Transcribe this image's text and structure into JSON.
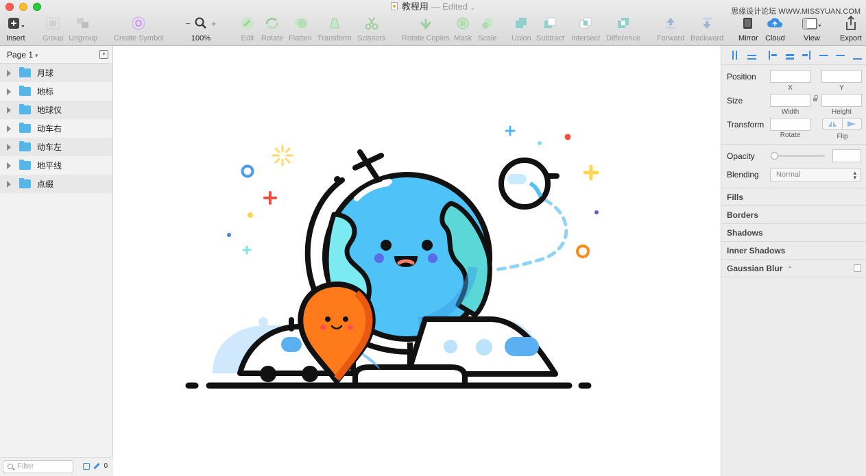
{
  "window": {
    "title": "教程用",
    "edited": "— Edited",
    "watermark": "思缘设计论坛 WWW.MISSYUAN.COM"
  },
  "toolbar": {
    "insert": "Insert",
    "group": "Group",
    "ungroup": "Ungroup",
    "create_symbol": "Create Symbol",
    "zoom_value": "100%",
    "zoom_minus": "−",
    "zoom_plus": "+",
    "edit": "Edit",
    "rotate": "Rotate",
    "flatten": "Flatten",
    "transform": "Transform",
    "scissors": "Scissors",
    "rotate_copies": "Rotate Copies",
    "mask": "Mask",
    "scale": "Scale",
    "union": "Union",
    "subtract": "Subtract",
    "intersect": "Intersect",
    "difference": "Difference",
    "forward": "Forward",
    "backward": "Backward",
    "mirror": "Mirror",
    "cloud": "Cloud",
    "view": "View",
    "export": "Export"
  },
  "sidebar": {
    "page": "Page 1",
    "layers": [
      {
        "name": "月球"
      },
      {
        "name": "地标"
      },
      {
        "name": "地球仪"
      },
      {
        "name": "动车右"
      },
      {
        "name": "动车左"
      },
      {
        "name": "地平线"
      },
      {
        "name": "点缀"
      }
    ],
    "filter_placeholder": "Filter",
    "filter_count": "0"
  },
  "inspector": {
    "position": "Position",
    "x": "X",
    "y": "Y",
    "size": "Size",
    "width": "Width",
    "height": "Height",
    "transform": "Transform",
    "rotate": "Rotate",
    "flip": "Flip",
    "opacity": "Opacity",
    "blending": "Blending",
    "blending_value": "Normal",
    "fills": "Fills",
    "borders": "Borders",
    "shadows": "Shadows",
    "inner_shadows": "Inner Shadows",
    "gaussian_blur": "Gaussian Blur"
  },
  "colors": {
    "globe_blue": "#4fc3f7",
    "globe_teal": "#5ad8d8",
    "pin_orange": "#ff7a1a",
    "train_blue": "#5ab0f0",
    "accent": "#3a8ee6"
  }
}
